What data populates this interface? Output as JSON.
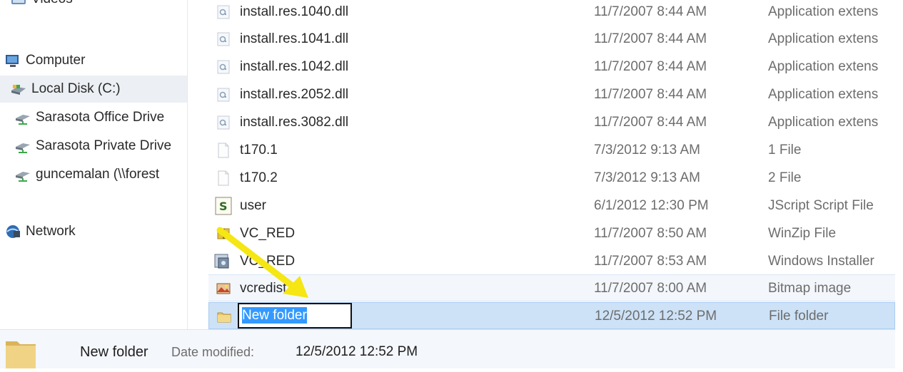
{
  "nav": {
    "items": [
      {
        "label": "Videos",
        "icon": "videos-library-icon"
      },
      {
        "label": "Computer",
        "icon": "computer-icon"
      },
      {
        "label": "Local Disk (C:)",
        "icon": "local-disk-icon"
      },
      {
        "label": "Sarasota Office  Drive",
        "icon": "network-drive-icon"
      },
      {
        "label": "Sarasota Private Drive",
        "icon": "network-drive-icon"
      },
      {
        "label": "guncemalan (\\\\forest",
        "icon": "network-drive-icon"
      },
      {
        "label": "Network",
        "icon": "network-icon"
      }
    ]
  },
  "files": [
    {
      "name": "install.res.1040.dll",
      "date": "11/7/2007 8:44 AM",
      "type": "Application extens",
      "icon": "dll-file-icon"
    },
    {
      "name": "install.res.1041.dll",
      "date": "11/7/2007 8:44 AM",
      "type": "Application extens",
      "icon": "dll-file-icon"
    },
    {
      "name": "install.res.1042.dll",
      "date": "11/7/2007 8:44 AM",
      "type": "Application extens",
      "icon": "dll-file-icon"
    },
    {
      "name": "install.res.2052.dll",
      "date": "11/7/2007 8:44 AM",
      "type": "Application extens",
      "icon": "dll-file-icon"
    },
    {
      "name": "install.res.3082.dll",
      "date": "11/7/2007 8:44 AM",
      "type": "Application extens",
      "icon": "dll-file-icon"
    },
    {
      "name": "t170.1",
      "date": "7/3/2012 9:13 AM",
      "type": "1 File",
      "icon": "blank-file-icon"
    },
    {
      "name": "t170.2",
      "date": "7/3/2012 9:13 AM",
      "type": "2 File",
      "icon": "blank-file-icon"
    },
    {
      "name": "user",
      "date": "6/1/2012 12:30 PM",
      "type": "JScript Script File",
      "icon": "jscript-file-icon"
    },
    {
      "name": "VC_RED",
      "date": "11/7/2007 8:50 AM",
      "type": "WinZip File",
      "icon": "winzip-file-icon"
    },
    {
      "name": "VC_RED",
      "date": "11/7/2007 8:53 AM",
      "type": "Windows Installer",
      "icon": "installer-file-icon"
    },
    {
      "name": "vcredist",
      "date": "11/7/2007 8:00 AM",
      "type": "Bitmap image",
      "icon": "bitmap-file-icon"
    },
    {
      "name": "New folder",
      "date": "12/5/2012 12:52 PM",
      "type": "File folder",
      "icon": "folder-icon"
    }
  ],
  "rename": {
    "value": "New folder"
  },
  "details": {
    "name": "New folder",
    "label": "Date modified:",
    "value": "12/5/2012 12:52 PM",
    "icon": "folder-icon"
  },
  "colors": {
    "selection": "#cde2f7",
    "rename_highlight": "#3399ff",
    "arrow": "#f5e614"
  }
}
